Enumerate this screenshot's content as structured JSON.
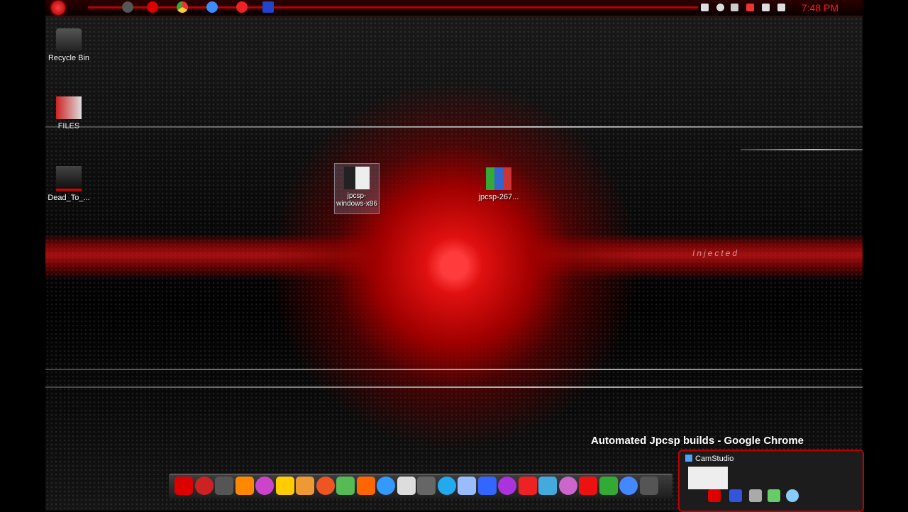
{
  "clock": {
    "time": "7:48 PM"
  },
  "desktop": {
    "icons": [
      {
        "label": "Recycle Bin"
      },
      {
        "label": "FILES"
      },
      {
        "label": "Dead_To_..."
      },
      {
        "label": "jpcsp-windows-x86"
      },
      {
        "label": "jpcsp-267..."
      }
    ],
    "wallpaper_text": "Injected"
  },
  "tooltip": {
    "text": "Automated Jpcsp builds - Google Chrome"
  },
  "camstudio": {
    "title": "CamStudio"
  },
  "colors": {
    "accent": "#cc0000",
    "background": "#000000",
    "clock": "#ff1a1a"
  },
  "quicklaunch": [
    "start-orb-icon",
    "app-icon",
    "opera-icon",
    "chrome-icon",
    "ie-icon",
    "media-player-icon",
    "window-icon"
  ],
  "tray": [
    "notepad-icon",
    "globe-icon",
    "pen-icon",
    "signal-icon",
    "flag-icon",
    "network-icon"
  ],
  "dock": [
    "folder-icon",
    "alienware-icon",
    "x-icon",
    "vlc-icon",
    "paint-icon",
    "winamp-icon",
    "tools-icon",
    "browser-icon",
    "note-icon",
    "orb-icon",
    "itunes-icon",
    "calendar-icon",
    "clock-icon",
    "skype-icon",
    "docs-icon",
    "firefox-icon",
    "ball-icon",
    "youtube-icon",
    "play-icon",
    "bubbles-icon",
    "opera-icon",
    "chrome-icon",
    "mail-icon",
    "folder2-icon"
  ]
}
